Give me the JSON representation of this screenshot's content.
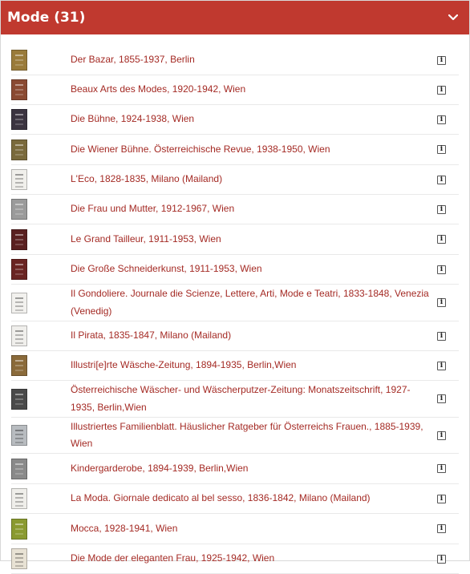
{
  "header": {
    "title": "Mode (31)"
  },
  "info_glyph": "i",
  "colors": {
    "header_bg": "#c0392f",
    "link": "#a42a24"
  },
  "items": [
    {
      "title": "Der Bazar, 1855-1937, Berlin",
      "thumb": "#9a7b3a"
    },
    {
      "title": "Beaux Arts des Modes, 1920-1942, Wien",
      "thumb": "#8a4a32"
    },
    {
      "title": "Die Bühne, 1924-1938, Wien",
      "thumb": "#3b3440"
    },
    {
      "title": "Die Wiener Bühne. Österreichische Revue, 1938-1950, Wien",
      "thumb": "#7a6a3c"
    },
    {
      "title": "L'Eco, 1828-1835, Milano (Mailand)",
      "thumb": "#f0efeb"
    },
    {
      "title": "Die Frau und Mutter, 1912-1967, Wien",
      "thumb": "#9b9b9b"
    },
    {
      "title": "Le Grand Tailleur, 1911-1953, Wien",
      "thumb": "#5a2020"
    },
    {
      "title": "Die Große Schneiderkunst, 1911-1953, Wien",
      "thumb": "#6a2422"
    },
    {
      "title": "Il Gondoliere. Journale die Scienze, Lettere, Arti, Mode e Teatri, 1833-1848, Venezia (Venedig)",
      "thumb": "#f2f1ee"
    },
    {
      "title": "Il Pirata, 1835-1847, Milano (Mailand)",
      "thumb": "#f0efec"
    },
    {
      "title": "Illustri[e]rte Wäsche-Zeitung, 1894-1935, Berlin,Wien",
      "thumb": "#8a6a3a"
    },
    {
      "title": "Österreichische Wäscher- und Wäscherputzer-Zeitung: Monatszeitschrift, 1927-1935, Berlin,Wien",
      "thumb": "#4a4a4a"
    },
    {
      "title": "Illustriertes Familienblatt. Häuslicher Ratgeber für Österreichs Frauen., 1885-1939, Wien",
      "thumb": "#b8bcc0"
    },
    {
      "title": "Kindergarderobe, 1894-1939, Berlin,Wien",
      "thumb": "#8a8a8a"
    },
    {
      "title": "La Moda. Giornale dedicato al bel sesso, 1836-1842, Milano (Mailand)",
      "thumb": "#efeeea"
    },
    {
      "title": "Mocca, 1928-1941, Wien",
      "thumb": "#8a9a30"
    },
    {
      "title": "Die Mode der eleganten Frau, 1925-1942, Wien",
      "thumb": "#e8e2d4"
    }
  ]
}
